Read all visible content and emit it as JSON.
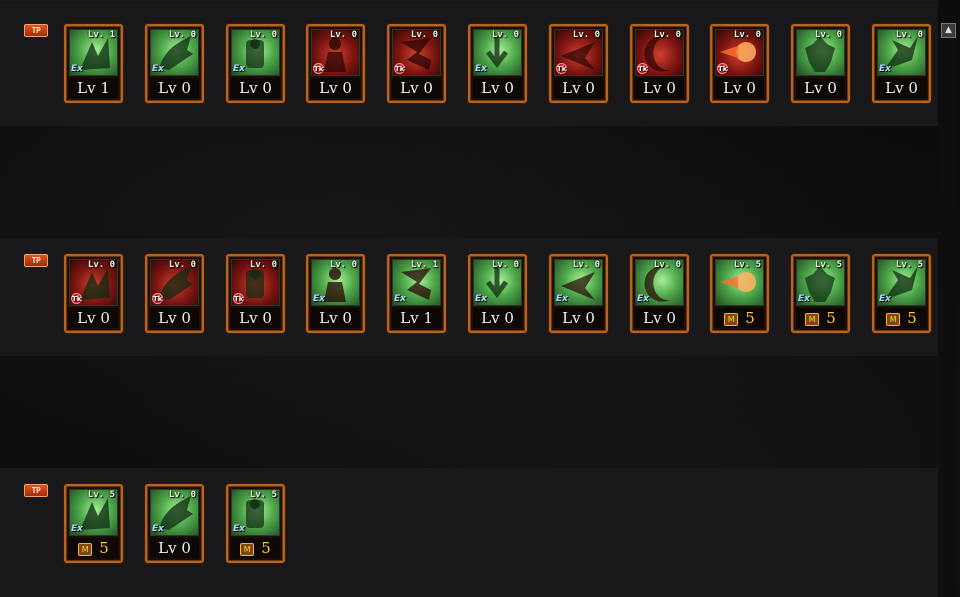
{
  "tp_label": "TP",
  "scroll_up_symbol": "▲",
  "rows": [
    {
      "skills": [
        {
          "icon": "ex-skill-burst-icon",
          "bg": "green",
          "badge": "EX",
          "top": "Lv. 1",
          "bottom": "Lv 1",
          "max": false
        },
        {
          "icon": "ex-skill-claw-icon",
          "bg": "green",
          "badge": "EX",
          "top": "Lv. 0",
          "bottom": "Lv 0",
          "max": false
        },
        {
          "icon": "ex-skill-guard-icon",
          "bg": "green",
          "badge": "EX",
          "top": "Lv. 0",
          "bottom": "Lv 0",
          "max": false
        },
        {
          "icon": "tk-skill-aura-icon",
          "bg": "red",
          "badge": "TK",
          "top": "Lv. 0",
          "bottom": "Lv 0",
          "max": false
        },
        {
          "icon": "tk-skill-kick-icon",
          "bg": "red",
          "badge": "TK",
          "top": "Lv. 0",
          "bottom": "Lv 0",
          "max": false
        },
        {
          "icon": "ex-skill-drop-icon",
          "bg": "green",
          "badge": "EX",
          "top": "Lv. 0",
          "bottom": "Lv 0",
          "max": false
        },
        {
          "icon": "tk-skill-dash-icon",
          "bg": "red",
          "badge": "TK",
          "top": "Lv. 0",
          "bottom": "Lv 0",
          "max": false
        },
        {
          "icon": "tk-skill-crescent-icon",
          "bg": "red",
          "badge": "TK",
          "top": "Lv. 0",
          "bottom": "Lv 0",
          "max": false
        },
        {
          "icon": "tk-skill-fireball-icon",
          "bg": "red",
          "badge": "TK",
          "top": "Lv. 0",
          "bottom": "Lv 0",
          "max": false
        },
        {
          "icon": "skill-muscle-icon",
          "bg": "green",
          "badge": "",
          "top": "Lv. 0",
          "bottom": "Lv 0",
          "max": false
        },
        {
          "icon": "ex-skill-strike-icon",
          "bg": "green",
          "badge": "EX",
          "top": "Lv. 0",
          "bottom": "Lv 0",
          "max": false
        }
      ]
    },
    {
      "skills": [
        {
          "icon": "tk-skill-shockwave-icon",
          "bg": "red",
          "badge": "TK",
          "top": "Lv. 0",
          "bottom": "Lv 0",
          "max": false
        },
        {
          "icon": "tk-skill-rush-icon",
          "bg": "red",
          "badge": "TK",
          "top": "Lv. 0",
          "bottom": "Lv 0",
          "max": false
        },
        {
          "icon": "tk-skill-slide-icon",
          "bg": "red",
          "badge": "TK",
          "top": "Lv. 0",
          "bottom": "Lv 0",
          "max": false
        },
        {
          "icon": "ex-skill-arrow-icon",
          "bg": "green",
          "badge": "EX",
          "top": "Lv. 0",
          "bottom": "Lv 0",
          "max": false
        },
        {
          "icon": "ex-skill-spin-icon",
          "bg": "green",
          "badge": "EX",
          "top": "Lv. 1",
          "bottom": "Lv 1",
          "max": false
        },
        {
          "icon": "ex-skill-uppercut-icon",
          "bg": "green",
          "badge": "EX",
          "top": "Lv. 0",
          "bottom": "Lv 0",
          "max": false
        },
        {
          "icon": "ex-skill-bind-icon",
          "bg": "green",
          "badge": "EX",
          "top": "Lv. 0",
          "bottom": "Lv 0",
          "max": false
        },
        {
          "icon": "ex-skill-rise-icon",
          "bg": "green",
          "badge": "EX",
          "top": "Lv. 0",
          "bottom": "Lv 0",
          "max": false
        },
        {
          "icon": "skill-explosion-icon",
          "bg": "green",
          "badge": "",
          "top": "Lv. 5",
          "bottom": "5",
          "max": true
        },
        {
          "icon": "ex-skill-slash-icon",
          "bg": "green",
          "badge": "EX",
          "top": "Lv. 5",
          "bottom": "5",
          "max": true
        },
        {
          "icon": "ex-skill-vortex-icon",
          "bg": "green",
          "badge": "EX",
          "top": "Lv. 5",
          "bottom": "5",
          "max": true
        }
      ]
    },
    {
      "skills": [
        {
          "icon": "ex-skill-spike-icon",
          "bg": "green",
          "badge": "EX",
          "top": "Lv. 5",
          "bottom": "5",
          "max": true
        },
        {
          "icon": "ex-skill-fist-icon",
          "bg": "green",
          "badge": "EX",
          "top": "Lv. 0",
          "bottom": "Lv 0",
          "max": false
        },
        {
          "icon": "ex-skill-spiral-icon",
          "bg": "green",
          "badge": "EX",
          "top": "Lv. 5",
          "bottom": "5",
          "max": true
        }
      ]
    }
  ],
  "max_mark": "M",
  "ex_text": "Ex",
  "tk_text": "Tk"
}
